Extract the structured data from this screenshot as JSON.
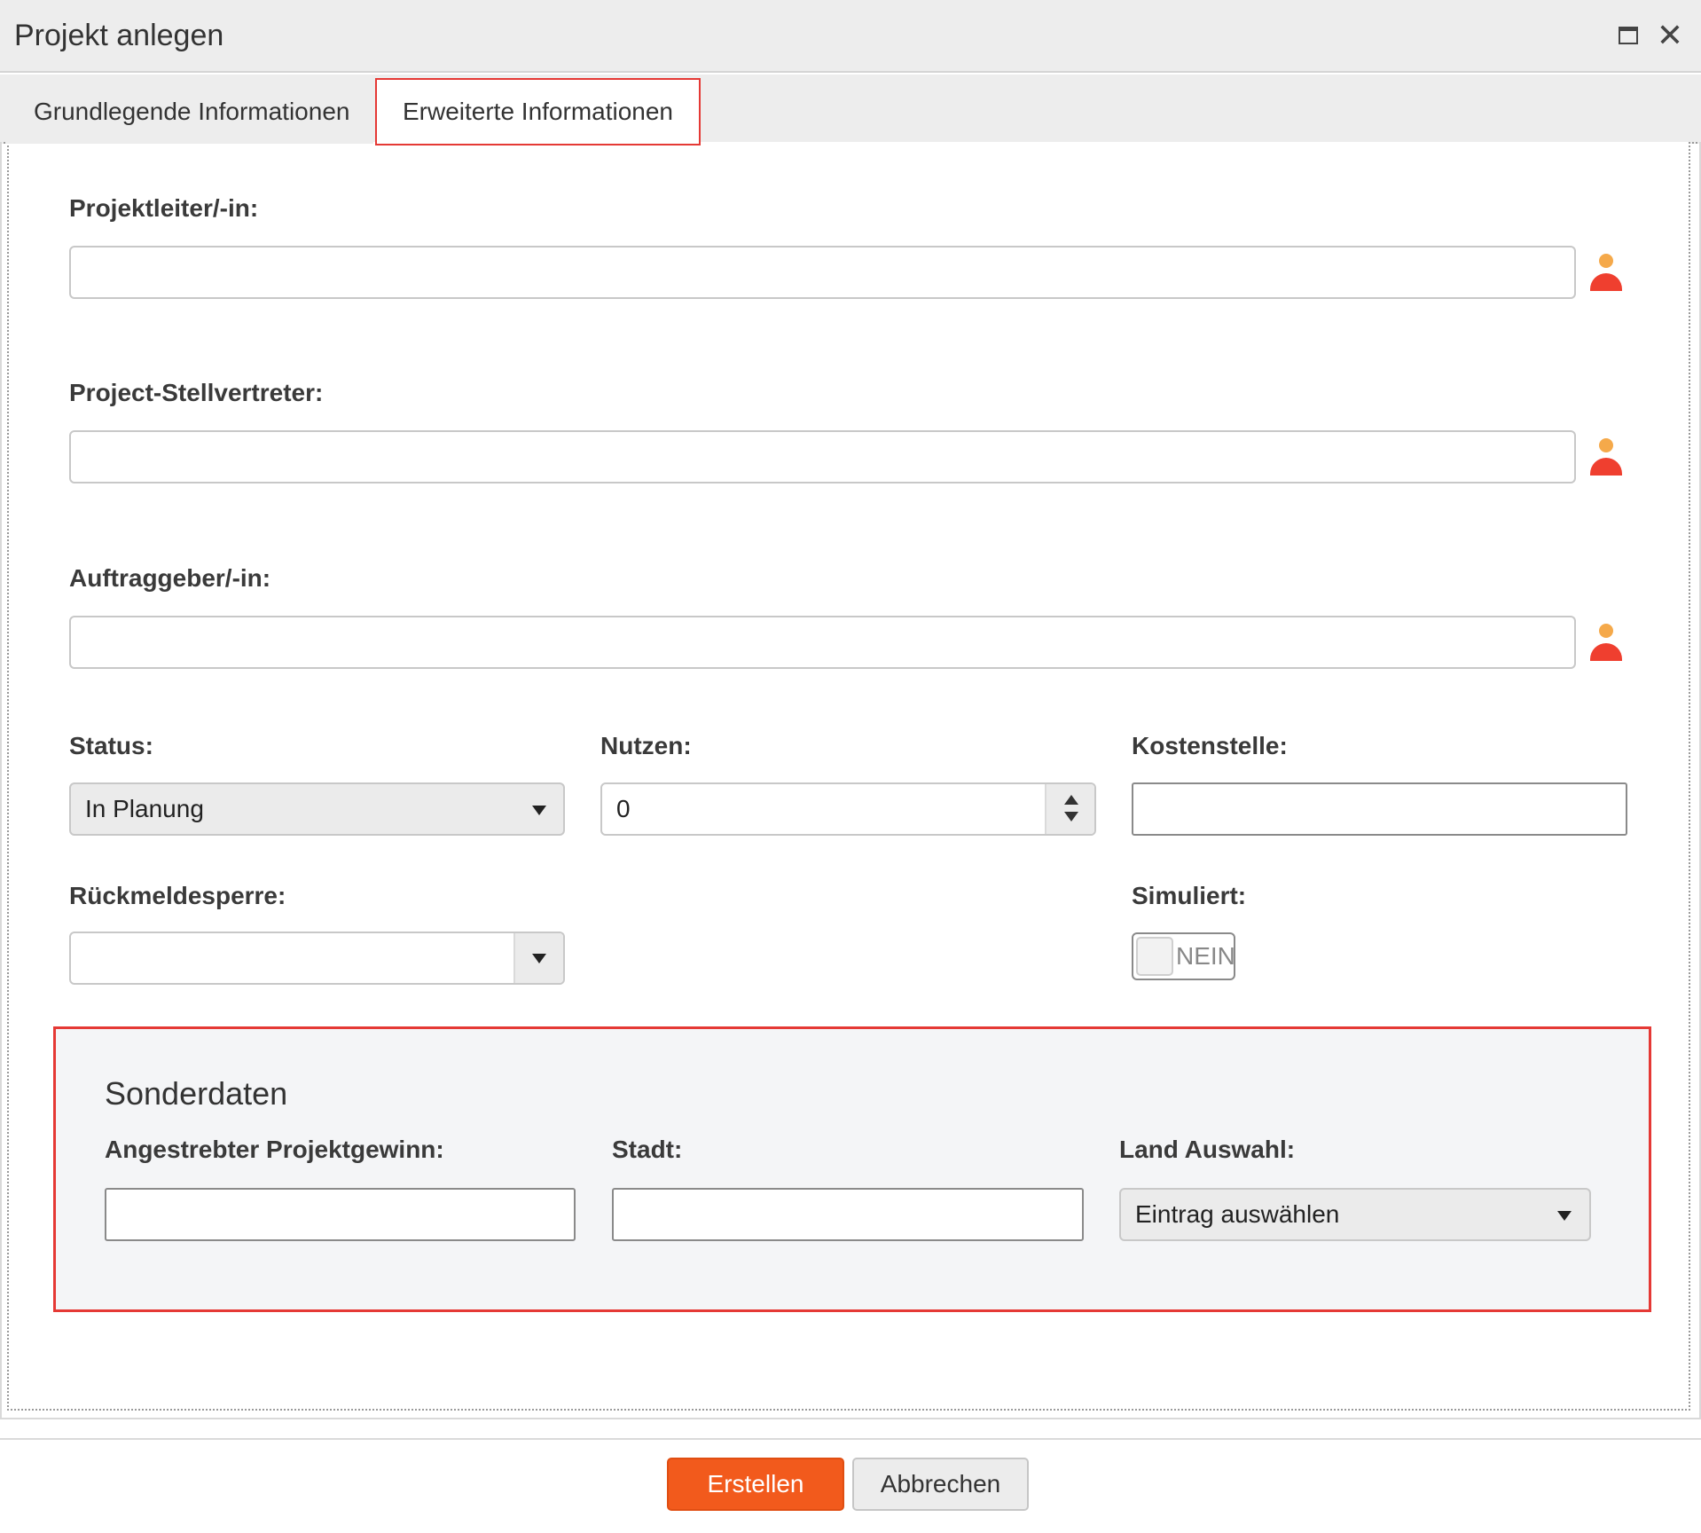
{
  "dialog": {
    "title": "Projekt anlegen"
  },
  "tabs": [
    {
      "label": "Grundlegende Informationen",
      "active": false
    },
    {
      "label": "Erweiterte Informationen",
      "active": true
    }
  ],
  "form": {
    "project_lead_label": "Projektleiter/-in:",
    "project_lead_value": "",
    "deputy_label": "Project-Stellvertreter:",
    "deputy_value": "",
    "client_label": "Auftraggeber/-in:",
    "client_value": "",
    "status_label": "Status:",
    "status_value": "In Planung",
    "benefit_label": "Nutzen:",
    "benefit_value": "0",
    "cost_center_label": "Kostenstelle:",
    "cost_center_value": "",
    "feedback_lock_label": "Rückmeldesperre:",
    "feedback_lock_value": "",
    "simulated_label": "Simuliert:",
    "simulated_value": "NEIN"
  },
  "special_data": {
    "title": "Sonderdaten",
    "target_profit_label": "Angestrebter Projektgewinn:",
    "target_profit_value": "",
    "city_label": "Stadt:",
    "city_value": "",
    "country_label": "Land Auswahl:",
    "country_value": "Eintrag auswählen"
  },
  "footer": {
    "create_label": "Erstellen",
    "cancel_label": "Abbrechen"
  },
  "colors": {
    "accent": "#f25a1c",
    "highlight_border": "#e53935",
    "person_icon_head": "#f5a94a",
    "person_icon_body": "#ef3f2f"
  }
}
